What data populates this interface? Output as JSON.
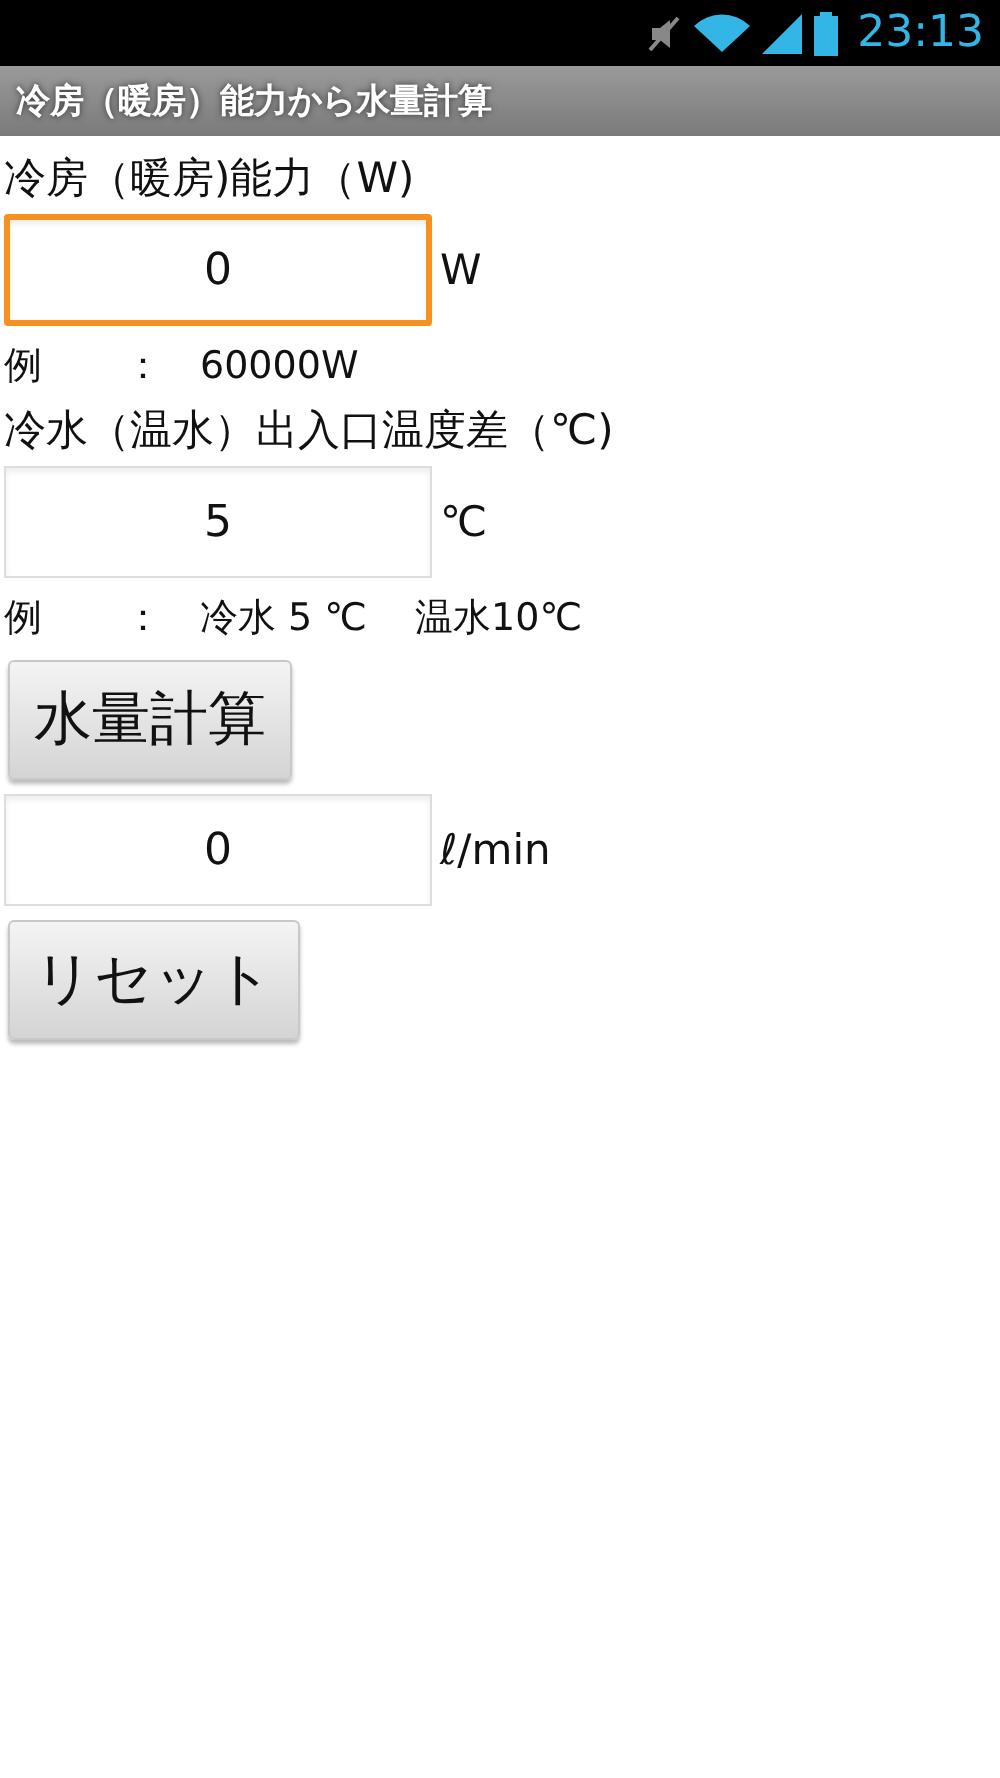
{
  "status_bar": {
    "time": "23:13"
  },
  "title_bar": {
    "title": "冷房（暖房）能力から水量計算"
  },
  "sections": [
    {
      "kind": "input",
      "label": "冷房（暖房)能力（W)",
      "value": "0",
      "unit": "W",
      "focused": true,
      "example": [
        "例",
        "：",
        "60000W"
      ]
    },
    {
      "kind": "input",
      "label": "冷水（温水）出入口温度差（℃)",
      "value": "5",
      "unit": "℃",
      "focused": false,
      "example": [
        "例",
        "：",
        "冷水 5 ℃",
        "温水10℃"
      ]
    },
    {
      "kind": "button",
      "label": "水量計算"
    },
    {
      "kind": "output",
      "value": "0",
      "unit": "ℓ/min",
      "focused": false
    },
    {
      "kind": "button",
      "label": "リセット"
    }
  ]
}
